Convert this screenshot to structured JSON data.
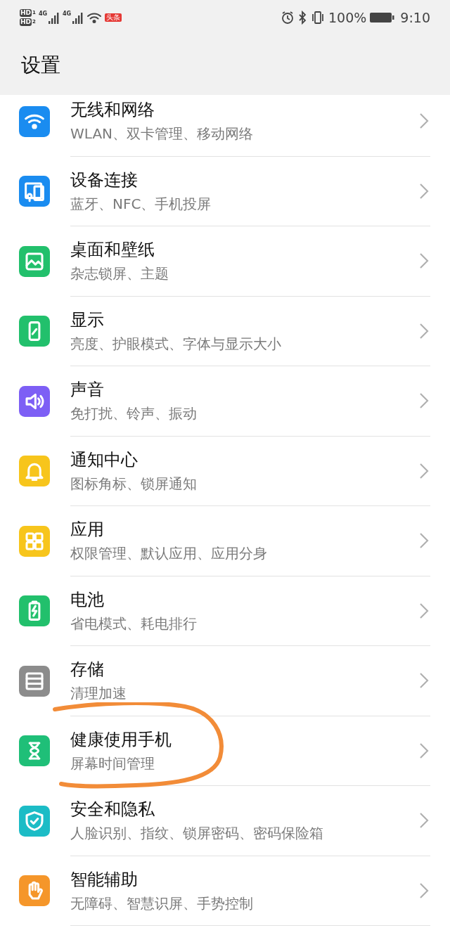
{
  "status_bar": {
    "hd_labels": [
      "HD",
      "HD"
    ],
    "sim_slots": [
      "1",
      "2"
    ],
    "network_labels": [
      "4G",
      "4G"
    ],
    "notification_badge": "头条",
    "battery": "100%",
    "time": "9:10"
  },
  "header": {
    "title": "设置"
  },
  "items": [
    {
      "title": "无线和网络",
      "subtitle": "WLAN、双卡管理、移动网络",
      "color": "#1a8cf0",
      "annotated": false
    },
    {
      "title": "设备连接",
      "subtitle": "蓝牙、NFC、手机投屏",
      "color": "#1a8cf0",
      "annotated": false
    },
    {
      "title": "桌面和壁纸",
      "subtitle": "杂志锁屏、主题",
      "color": "#22c06c",
      "annotated": false
    },
    {
      "title": "显示",
      "subtitle": "亮度、护眼模式、字体与显示大小",
      "color": "#22c06c",
      "annotated": false
    },
    {
      "title": "声音",
      "subtitle": "免打扰、铃声、振动",
      "color": "#7d5ff5",
      "annotated": false
    },
    {
      "title": "通知中心",
      "subtitle": "图标角标、锁屏通知",
      "color": "#f7c51c",
      "annotated": false
    },
    {
      "title": "应用",
      "subtitle": "权限管理、默认应用、应用分身",
      "color": "#f7c51c",
      "annotated": false
    },
    {
      "title": "电池",
      "subtitle": "省电模式、耗电排行",
      "color": "#22c06c",
      "annotated": false
    },
    {
      "title": "存储",
      "subtitle": "清理加速",
      "color": "#8c8c8c",
      "annotated": false
    },
    {
      "title": "健康使用手机",
      "subtitle": "屏幕时间管理",
      "color": "#1fbf78",
      "annotated": true
    },
    {
      "title": "安全和隐私",
      "subtitle": "人脸识别、指纹、锁屏密码、密码保险箱",
      "color": "#1cbcc6",
      "annotated": false
    },
    {
      "title": "智能辅助",
      "subtitle": "无障碍、智慧识屏、手势控制",
      "color": "#f5962a",
      "annotated": false
    }
  ]
}
